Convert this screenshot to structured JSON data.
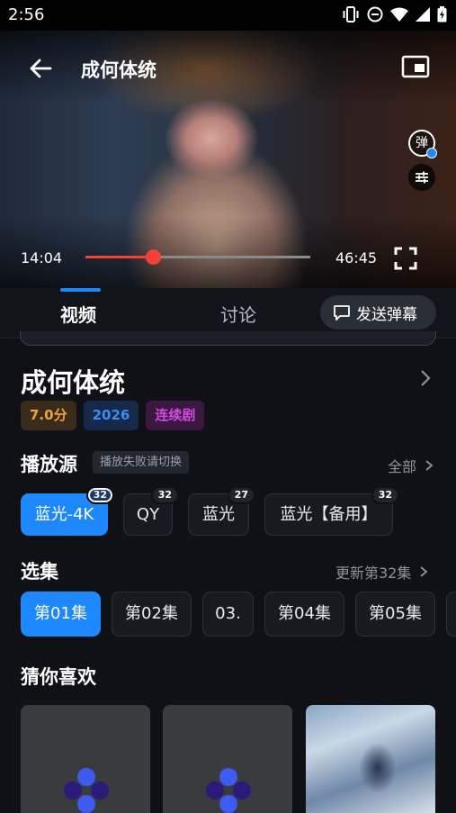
{
  "status_bar": {
    "time": "2:56"
  },
  "player": {
    "title": "成何体统",
    "current_time": "14:04",
    "total_time": "46:45",
    "progress": 0.3,
    "danmu_label": "弹"
  },
  "tabs": {
    "video": "视频",
    "discuss": "讨论",
    "send_danmu": "发送弹幕"
  },
  "show": {
    "title": "成何体统",
    "tags": {
      "score": "7.0分",
      "year": "2026",
      "type": "连续剧"
    }
  },
  "sources": {
    "title": "播放源",
    "hint": "播放失败请切换",
    "more": "全部",
    "items": [
      {
        "label": "蓝光-4K",
        "count": "32"
      },
      {
        "label": "QY",
        "count": "32"
      },
      {
        "label": "蓝光",
        "count": "27"
      },
      {
        "label": "蓝光【备用】",
        "count": "32"
      }
    ]
  },
  "episodes": {
    "title": "选集",
    "more": "更新第32集",
    "items": [
      "第01集",
      "第02集",
      "03.",
      "第04集",
      "第05集"
    ]
  },
  "recommend": {
    "title": "猜你喜欢"
  },
  "colors": {
    "accent": "#1e88ff",
    "progress": "#f44336",
    "background": "#0f1116"
  }
}
